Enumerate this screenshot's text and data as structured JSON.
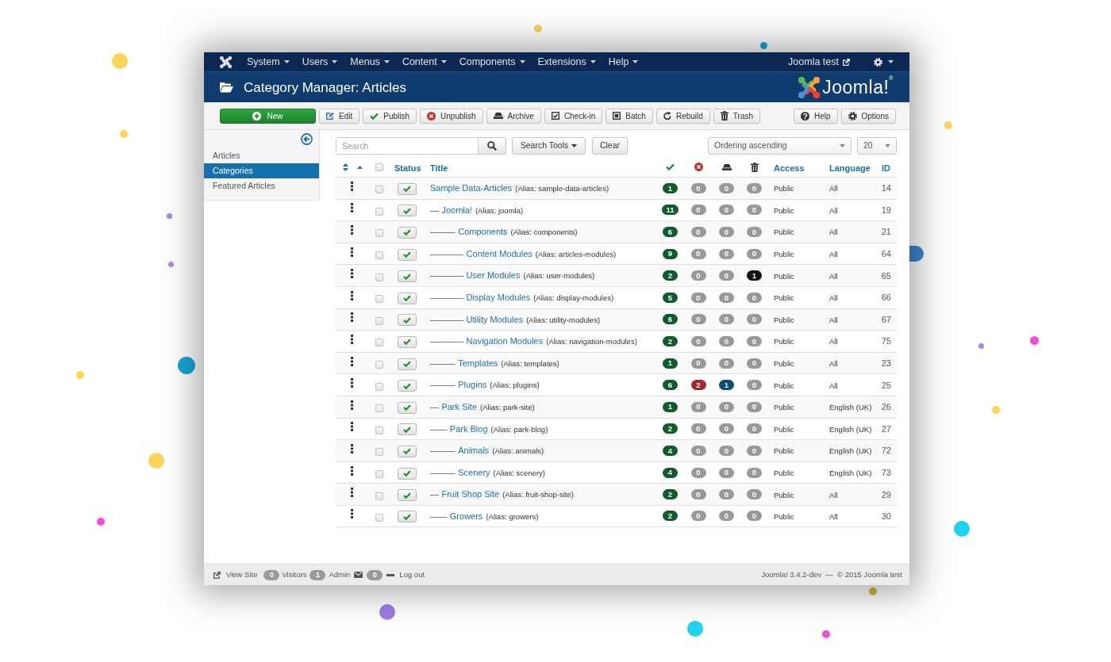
{
  "nav": {
    "items": [
      {
        "label": "System"
      },
      {
        "label": "Users"
      },
      {
        "label": "Menus"
      },
      {
        "label": "Content"
      },
      {
        "label": "Components"
      },
      {
        "label": "Extensions"
      },
      {
        "label": "Help"
      }
    ],
    "site_link": "Joomla test"
  },
  "header": {
    "title": "Category Manager: Articles",
    "logo_text": "Joomla!$^{®}$"
  },
  "toolbar": {
    "buttons": [
      {
        "label": "New",
        "kind": "success"
      },
      {
        "label": "Edit",
        "kind": "default"
      },
      {
        "label": "Publish",
        "kind": "default"
      },
      {
        "label": "Unpublish",
        "kind": "default"
      },
      {
        "label": "Archive",
        "kind": "default"
      },
      {
        "label": "Check-in",
        "kind": "default"
      },
      {
        "label": "Batch",
        "kind": "default"
      },
      {
        "label": "Rebuild",
        "kind": "default"
      },
      {
        "label": "Trash",
        "kind": "default"
      }
    ],
    "right_buttons": [
      {
        "label": "Help"
      },
      {
        "label": "Options"
      }
    ]
  },
  "sidebar": {
    "items": [
      {
        "label": "Articles",
        "selected": false
      },
      {
        "label": "Categories",
        "selected": true
      },
      {
        "label": "Featured Articles",
        "selected": false
      }
    ]
  },
  "filters": {
    "search": {
      "placeholder": "Search"
    },
    "search_tools": "Search Tools",
    "clear": "Clear",
    "ordering": "Ordering ascending",
    "limit": "20"
  },
  "table": {
    "header": {
      "checked": false,
      "status": "Status",
      "title": "Title",
      "access": "Access",
      "language": "Language",
      "id": "ID"
    },
    "rows": [
      {
        "title": "Sample Data-Articles",
        "alias": "(Alias: sample-data-articles)",
        "checked": false,
        "published": true,
        "counts": [
          {
            "text": "1",
            "color": "#0f5b2c"
          },
          {
            "text": "0",
            "color": "#999999"
          },
          {
            "text": "0",
            "color": "#999999"
          },
          {
            "text": "0",
            "color": "#999999"
          }
        ],
        "access": "Public",
        "language": "All",
        "id": "14"
      },
      {
        "prefix": "—",
        "title": "Joomla!",
        "alias": "(Alias: joomla)",
        "checked": false,
        "published": true,
        "counts": [
          {
            "text": "11",
            "color": "#0f5b2c"
          },
          {
            "text": "0",
            "color": "#999999"
          },
          {
            "text": "0",
            "color": "#999999"
          },
          {
            "text": "0",
            "color": "#999999"
          }
        ],
        "access": "Public",
        "language": "All",
        "id": "19"
      },
      {
        "prefix": "———",
        "title": "Components",
        "alias": "(Alias: components)",
        "checked": false,
        "published": true,
        "counts": [
          {
            "text": "6",
            "color": "#0f5b2c"
          },
          {
            "text": "0",
            "color": "#999999"
          },
          {
            "text": "0",
            "color": "#999999"
          },
          {
            "text": "0",
            "color": "#999999"
          }
        ],
        "access": "Public",
        "language": "All",
        "id": "21"
      },
      {
        "prefix": "————",
        "title": "Content Modules",
        "alias": "(Alias: articles-modules)",
        "checked": false,
        "published": true,
        "counts": [
          {
            "text": "9",
            "color": "#0f5b2c"
          },
          {
            "text": "0",
            "color": "#999999"
          },
          {
            "text": "0",
            "color": "#999999"
          },
          {
            "text": "0",
            "color": "#999999"
          }
        ],
        "access": "Public",
        "language": "All",
        "id": "64"
      },
      {
        "prefix": "————",
        "title": "User Modules",
        "alias": "(Alias: user-modules)",
        "checked": false,
        "published": true,
        "counts": [
          {
            "text": "2",
            "color": "#0f5b2c"
          },
          {
            "text": "0",
            "color": "#999999"
          },
          {
            "text": "0",
            "color": "#999999"
          },
          {
            "text": "1",
            "color": "#111111"
          }
        ],
        "access": "Public",
        "language": "All",
        "id": "65"
      },
      {
        "prefix": "————",
        "title": "Display Modules",
        "alias": "(Alias: display-modules)",
        "checked": false,
        "published": true,
        "counts": [
          {
            "text": "5",
            "color": "#0f5b2c"
          },
          {
            "text": "0",
            "color": "#999999"
          },
          {
            "text": "0",
            "color": "#999999"
          },
          {
            "text": "0",
            "color": "#999999"
          }
        ],
        "access": "Public",
        "language": "All",
        "id": "66"
      },
      {
        "prefix": "————",
        "title": "Utility Modules",
        "alias": "(Alias: utility-modules)",
        "checked": false,
        "published": true,
        "counts": [
          {
            "text": "6",
            "color": "#0f5b2c"
          },
          {
            "text": "0",
            "color": "#999999"
          },
          {
            "text": "0",
            "color": "#999999"
          },
          {
            "text": "0",
            "color": "#999999"
          }
        ],
        "access": "Public",
        "language": "All",
        "id": "67"
      },
      {
        "prefix": "————",
        "title": "Navigation Modules",
        "alias": "(Alias: navigation-modules)",
        "checked": false,
        "published": true,
        "counts": [
          {
            "text": "2",
            "color": "#0f5b2c"
          },
          {
            "text": "0",
            "color": "#999999"
          },
          {
            "text": "0",
            "color": "#999999"
          },
          {
            "text": "0",
            "color": "#999999"
          }
        ],
        "access": "Public",
        "language": "All",
        "id": "75"
      },
      {
        "prefix": "———",
        "title": "Templates",
        "alias": "(Alias: templates)",
        "checked": false,
        "published": true,
        "counts": [
          {
            "text": "1",
            "color": "#0f5b2c"
          },
          {
            "text": "0",
            "color": "#999999"
          },
          {
            "text": "0",
            "color": "#999999"
          },
          {
            "text": "0",
            "color": "#999999"
          }
        ],
        "access": "Public",
        "language": "All",
        "id": "23"
      },
      {
        "prefix": "———",
        "title": "Plugins",
        "alias": "(Alias: plugins)",
        "checked": false,
        "published": true,
        "counts": [
          {
            "text": "6",
            "color": "#0f5b2c"
          },
          {
            "text": "2",
            "color": "#a3282b"
          },
          {
            "text": "1",
            "color": "#0e4e6e"
          },
          {
            "text": "0",
            "color": "#999999"
          }
        ],
        "access": "Public",
        "language": "All",
        "id": "25"
      },
      {
        "prefix": "—",
        "title": "Park Site",
        "alias": "(Alias: park-site)",
        "checked": false,
        "published": true,
        "counts": [
          {
            "text": "1",
            "color": "#0f5b2c"
          },
          {
            "text": "0",
            "color": "#999999"
          },
          {
            "text": "0",
            "color": "#999999"
          },
          {
            "text": "0",
            "color": "#999999"
          }
        ],
        "access": "Public",
        "language": "English (UK)",
        "id": "26"
      },
      {
        "prefix": "——",
        "title": "Park Blog",
        "alias": "(Alias: park-blog)",
        "checked": false,
        "published": true,
        "counts": [
          {
            "text": "2",
            "color": "#0f5b2c"
          },
          {
            "text": "0",
            "color": "#999999"
          },
          {
            "text": "0",
            "color": "#999999"
          },
          {
            "text": "0",
            "color": "#999999"
          }
        ],
        "access": "Public",
        "language": "English (UK)",
        "id": "27"
      },
      {
        "prefix": "———",
        "title": "Animals",
        "alias": "(Alias: animals)",
        "checked": false,
        "published": true,
        "counts": [
          {
            "text": "4",
            "color": "#0f5b2c"
          },
          {
            "text": "0",
            "color": "#999999"
          },
          {
            "text": "0",
            "color": "#999999"
          },
          {
            "text": "0",
            "color": "#999999"
          }
        ],
        "access": "Public",
        "language": "English (UK)",
        "id": "72"
      },
      {
        "prefix": "———",
        "title": "Scenery",
        "alias": "(Alias: scenery)",
        "checked": false,
        "published": true,
        "counts": [
          {
            "text": "4",
            "color": "#0f5b2c"
          },
          {
            "text": "0",
            "color": "#999999"
          },
          {
            "text": "0",
            "color": "#999999"
          },
          {
            "text": "0",
            "color": "#999999"
          }
        ],
        "access": "Public",
        "language": "English (UK)",
        "id": "73"
      },
      {
        "prefix": "—",
        "title": "Fruit Shop Site",
        "alias": "(Alias: fruit-shop-site)",
        "checked": false,
        "published": true,
        "counts": [
          {
            "text": "2",
            "color": "#0f5b2c"
          },
          {
            "text": "0",
            "color": "#999999"
          },
          {
            "text": "0",
            "color": "#999999"
          },
          {
            "text": "0",
            "color": "#999999"
          }
        ],
        "access": "Public",
        "language": "All",
        "id": "29"
      },
      {
        "prefix": "——",
        "title": "Growers",
        "alias": "(Alias: growers)",
        "checked": false,
        "published": true,
        "counts": [
          {
            "text": "2",
            "color": "#0f5b2c"
          },
          {
            "text": "0",
            "color": "#999999"
          },
          {
            "text": "0",
            "color": "#999999"
          },
          {
            "text": "0",
            "color": "#999999"
          }
        ],
        "access": "Public",
        "language": "All",
        "id": "30"
      }
    ]
  },
  "footer": {
    "view_site": "View Site",
    "visitors": {
      "count": "0",
      "label": "Visitors"
    },
    "admins": {
      "count": "1",
      "label": "Admin"
    },
    "messages": {
      "count": "0"
    },
    "logout": "Log out",
    "version": "Joomla! 3.4.2-dev  —  © 2015 Joomla test"
  }
}
